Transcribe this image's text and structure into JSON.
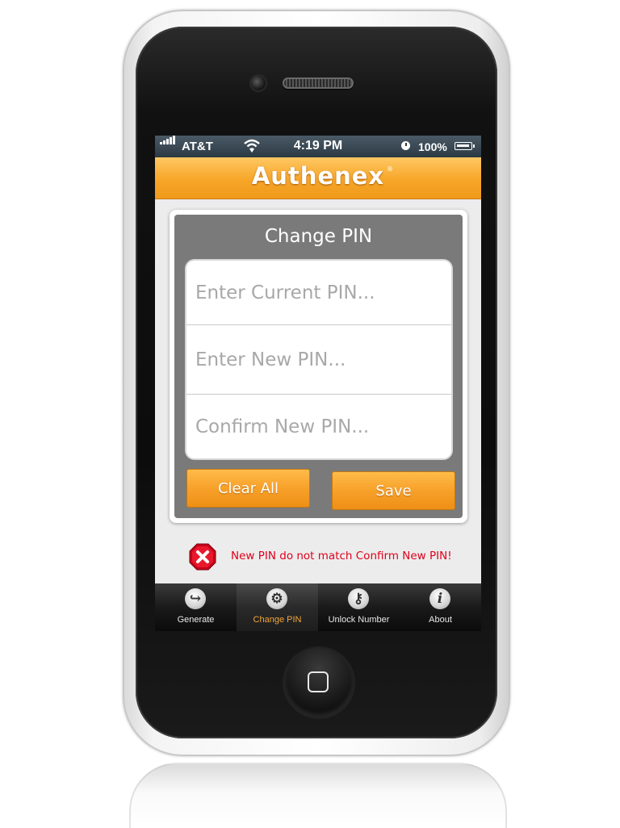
{
  "status_bar": {
    "carrier": "AT&T",
    "time": "4:19 PM",
    "battery": "100%"
  },
  "header": {
    "logo_text": "Authenex",
    "logo_mark": "®"
  },
  "form": {
    "title": "Change PIN",
    "current_pin_placeholder": "Enter Current PIN...",
    "new_pin_placeholder": "Enter New PIN...",
    "confirm_pin_placeholder": "Confirm New PIN...",
    "clear_label": "Clear All",
    "save_label": "Save"
  },
  "error": {
    "message": "New PIN do not match Confirm New PIN!",
    "icon": "error-x-icon",
    "color": "#e0001b"
  },
  "tabs": [
    {
      "label": "Generate",
      "icon": "generate-arrow-icon",
      "active": false
    },
    {
      "label": "Change PIN",
      "icon": "gear-icon",
      "active": true
    },
    {
      "label": "Unlock Number",
      "icon": "key-icon",
      "active": false
    },
    {
      "label": "About",
      "icon": "info-icon",
      "active": false
    }
  ],
  "colors": {
    "accent_orange": "#f7a629",
    "active_tab": "#f2a53a"
  }
}
